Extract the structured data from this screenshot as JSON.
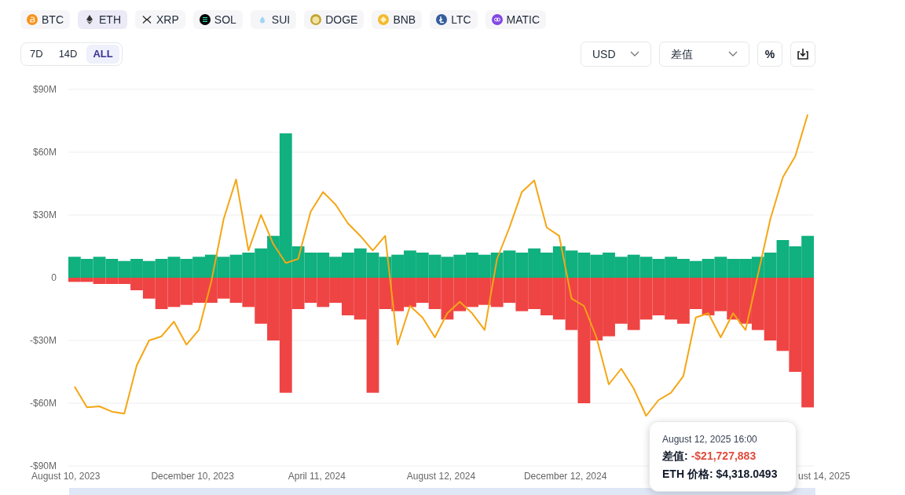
{
  "coins": [
    {
      "symbol": "BTC",
      "selected": false
    },
    {
      "symbol": "ETH",
      "selected": true
    },
    {
      "symbol": "XRP",
      "selected": false
    },
    {
      "symbol": "SOL",
      "selected": false
    },
    {
      "symbol": "SUI",
      "selected": false
    },
    {
      "symbol": "DOGE",
      "selected": false
    },
    {
      "symbol": "BNB",
      "selected": false
    },
    {
      "symbol": "LTC",
      "selected": false
    },
    {
      "symbol": "MATIC",
      "selected": false
    }
  ],
  "periods": [
    {
      "label": "7D",
      "selected": false
    },
    {
      "label": "14D",
      "selected": false
    },
    {
      "label": "ALL",
      "selected": true
    }
  ],
  "currency_select": {
    "value": "USD"
  },
  "metric_select": {
    "value": "差值"
  },
  "percent_button": {
    "label": "%"
  },
  "chart": {
    "chart_data": {
      "type": "bar",
      "stacked": true,
      "ylim": [
        -90,
        90
      ],
      "yticks": [
        {
          "value": 90,
          "label": "$90M"
        },
        {
          "value": 60,
          "label": "$60M"
        },
        {
          "value": 30,
          "label": "$30M"
        },
        {
          "value": 0,
          "label": "0"
        },
        {
          "value": -30,
          "label": "-$30M"
        },
        {
          "value": -60,
          "label": "-$60M"
        },
        {
          "value": -90,
          "label": "-$90M"
        }
      ],
      "grid": true,
      "series": [
        {
          "color": "#10b07f",
          "values": [
            10,
            9,
            10,
            9,
            8,
            9,
            8,
            9,
            10,
            9,
            10,
            11,
            10,
            11,
            12,
            14,
            20,
            69,
            15,
            12,
            12,
            10,
            12,
            14,
            12,
            10,
            11,
            13,
            12,
            11,
            10,
            11,
            12,
            11,
            12,
            13,
            12,
            14,
            12,
            15,
            13,
            12,
            11,
            12,
            10,
            11,
            10,
            9,
            10,
            9,
            8,
            9,
            10,
            9,
            9,
            10,
            12,
            18,
            15,
            20
          ]
        },
        {
          "color": "#ef4444",
          "values": [
            -2,
            -2,
            -3,
            -3,
            -3,
            -6,
            -10,
            -15,
            -14,
            -13,
            -12,
            -12,
            -10,
            -12,
            -14,
            -22,
            -30,
            -55,
            -15,
            -12,
            -14,
            -12,
            -18,
            -20,
            -55,
            -15,
            -16,
            -14,
            -12,
            -15,
            -20,
            -16,
            -14,
            -13,
            -14,
            -12,
            -16,
            -15,
            -18,
            -20,
            -25,
            -60,
            -30,
            -28,
            -22,
            -25,
            -20,
            -18,
            -20,
            -22,
            -15,
            -18,
            -16,
            -20,
            -22,
            -25,
            -30,
            -35,
            -45,
            -62
          ]
        },
        {
          "type": "line",
          "color": "#f5a614",
          "values": [
            -52,
            -62,
            -61.5,
            -64,
            -65,
            -42,
            -30,
            -28,
            -21,
            -32,
            -25,
            -2,
            28,
            47,
            13,
            30,
            16,
            7,
            9,
            31.5,
            41,
            35,
            26,
            20,
            13,
            20,
            -32,
            -13.5,
            -19,
            -28.5,
            -17,
            -11.5,
            -17,
            -25,
            9,
            24,
            41,
            46.5,
            24,
            20,
            -10,
            -13.5,
            -28.5,
            -51,
            -43.5,
            -53,
            -66,
            -58.5,
            -55,
            -47,
            -19,
            -17,
            -28.5,
            -17,
            -25,
            1.5,
            28,
            48,
            58,
            78
          ]
        }
      ]
    },
    "x_labels": [
      "August 10, 2023",
      "December 10, 2023",
      "April 11, 2024",
      "August 12, 2024",
      "December 12, 2024",
      "ust 14, 2025"
    ]
  },
  "zoom_slider": {
    "level": 1
  },
  "tooltip": {
    "time": "August 12, 2025 16:00",
    "diff_label": "差值:",
    "diff_value": "-$21,727,883",
    "price_label": "ETH 价格:",
    "price_value": "$4,318.0493"
  }
}
